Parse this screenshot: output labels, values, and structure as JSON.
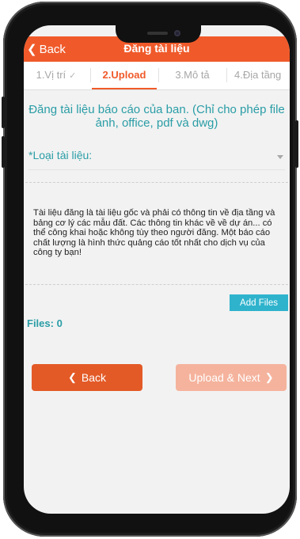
{
  "header": {
    "back_label": "Back",
    "back_icon": "chevron-left-icon",
    "title": "Đăng tài liệu",
    "color": "#f05a2a"
  },
  "tabs": [
    {
      "label": "1.Vị trí",
      "state": "done",
      "check": "✓"
    },
    {
      "label": "2.Upload",
      "state": "active"
    },
    {
      "label": "3.Mô tả",
      "state": "inactive"
    },
    {
      "label": "4.Địa tầng",
      "state": "inactive"
    }
  ],
  "form": {
    "subtitle": "Đăng tài liệu báo cáo của ban. (Chỉ cho phép file ảnh, office, pdf và dwg)",
    "doc_type_label": "*Loại tài liệu:",
    "note": "Tài liệu đăng là tài liệu gốc và phải có thông tin về địa tầng và bảng cơ lý các mẫu đất. Các thông tin khác về về dự án... có thể công khai hoặc không tùy theo người đăng. Một báo cáo chất lượng là hình thức quảng cáo tốt nhất cho dịch vụ của công ty bạn!",
    "add_files_label": "Add Files",
    "files_count_label": "Files: 0"
  },
  "footer": {
    "back_label": "Back",
    "next_label": "Upload & Next",
    "back_color": "#e35a27",
    "next_color": "#f5b39d"
  },
  "colors": {
    "accent": "#f05a2a",
    "teal": "#2a9da6",
    "add_files": "#2fb3cd"
  }
}
